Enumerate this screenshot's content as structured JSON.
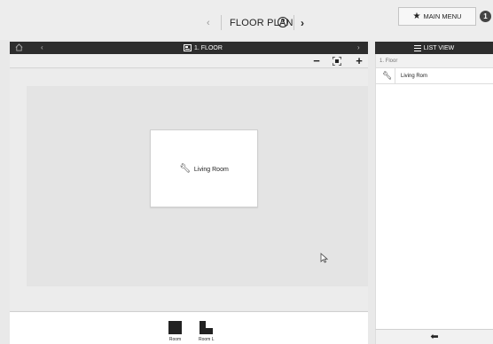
{
  "header": {
    "prev_label": "‹",
    "title": "FLOOR PLAN",
    "help_label": "?",
    "next_label": "›",
    "main_menu_label": "MAIN MENU",
    "notification_count": "1"
  },
  "floor_nav": {
    "prev_label": "‹",
    "floor_label": "1. FLOOR",
    "next_label": "›"
  },
  "zoom": {
    "zoom_out_label": "−",
    "zoom_in_label": "+"
  },
  "canvas": {
    "rooms": [
      {
        "label": "Living Room"
      }
    ]
  },
  "palette": {
    "items": [
      {
        "label": "Room"
      },
      {
        "label": "Room L"
      }
    ]
  },
  "list": {
    "title": "LIST VIEW",
    "floor": "1. Floor",
    "rows": [
      {
        "label": "Living Rom"
      }
    ],
    "back_label": "🡄"
  },
  "icons": [
    "home-icon",
    "floor-icon",
    "zoom-fit-icon",
    "list-icon",
    "wrench-icon",
    "star-icon",
    "help-icon",
    "cursor-icon",
    "back-arrow-icon"
  ]
}
